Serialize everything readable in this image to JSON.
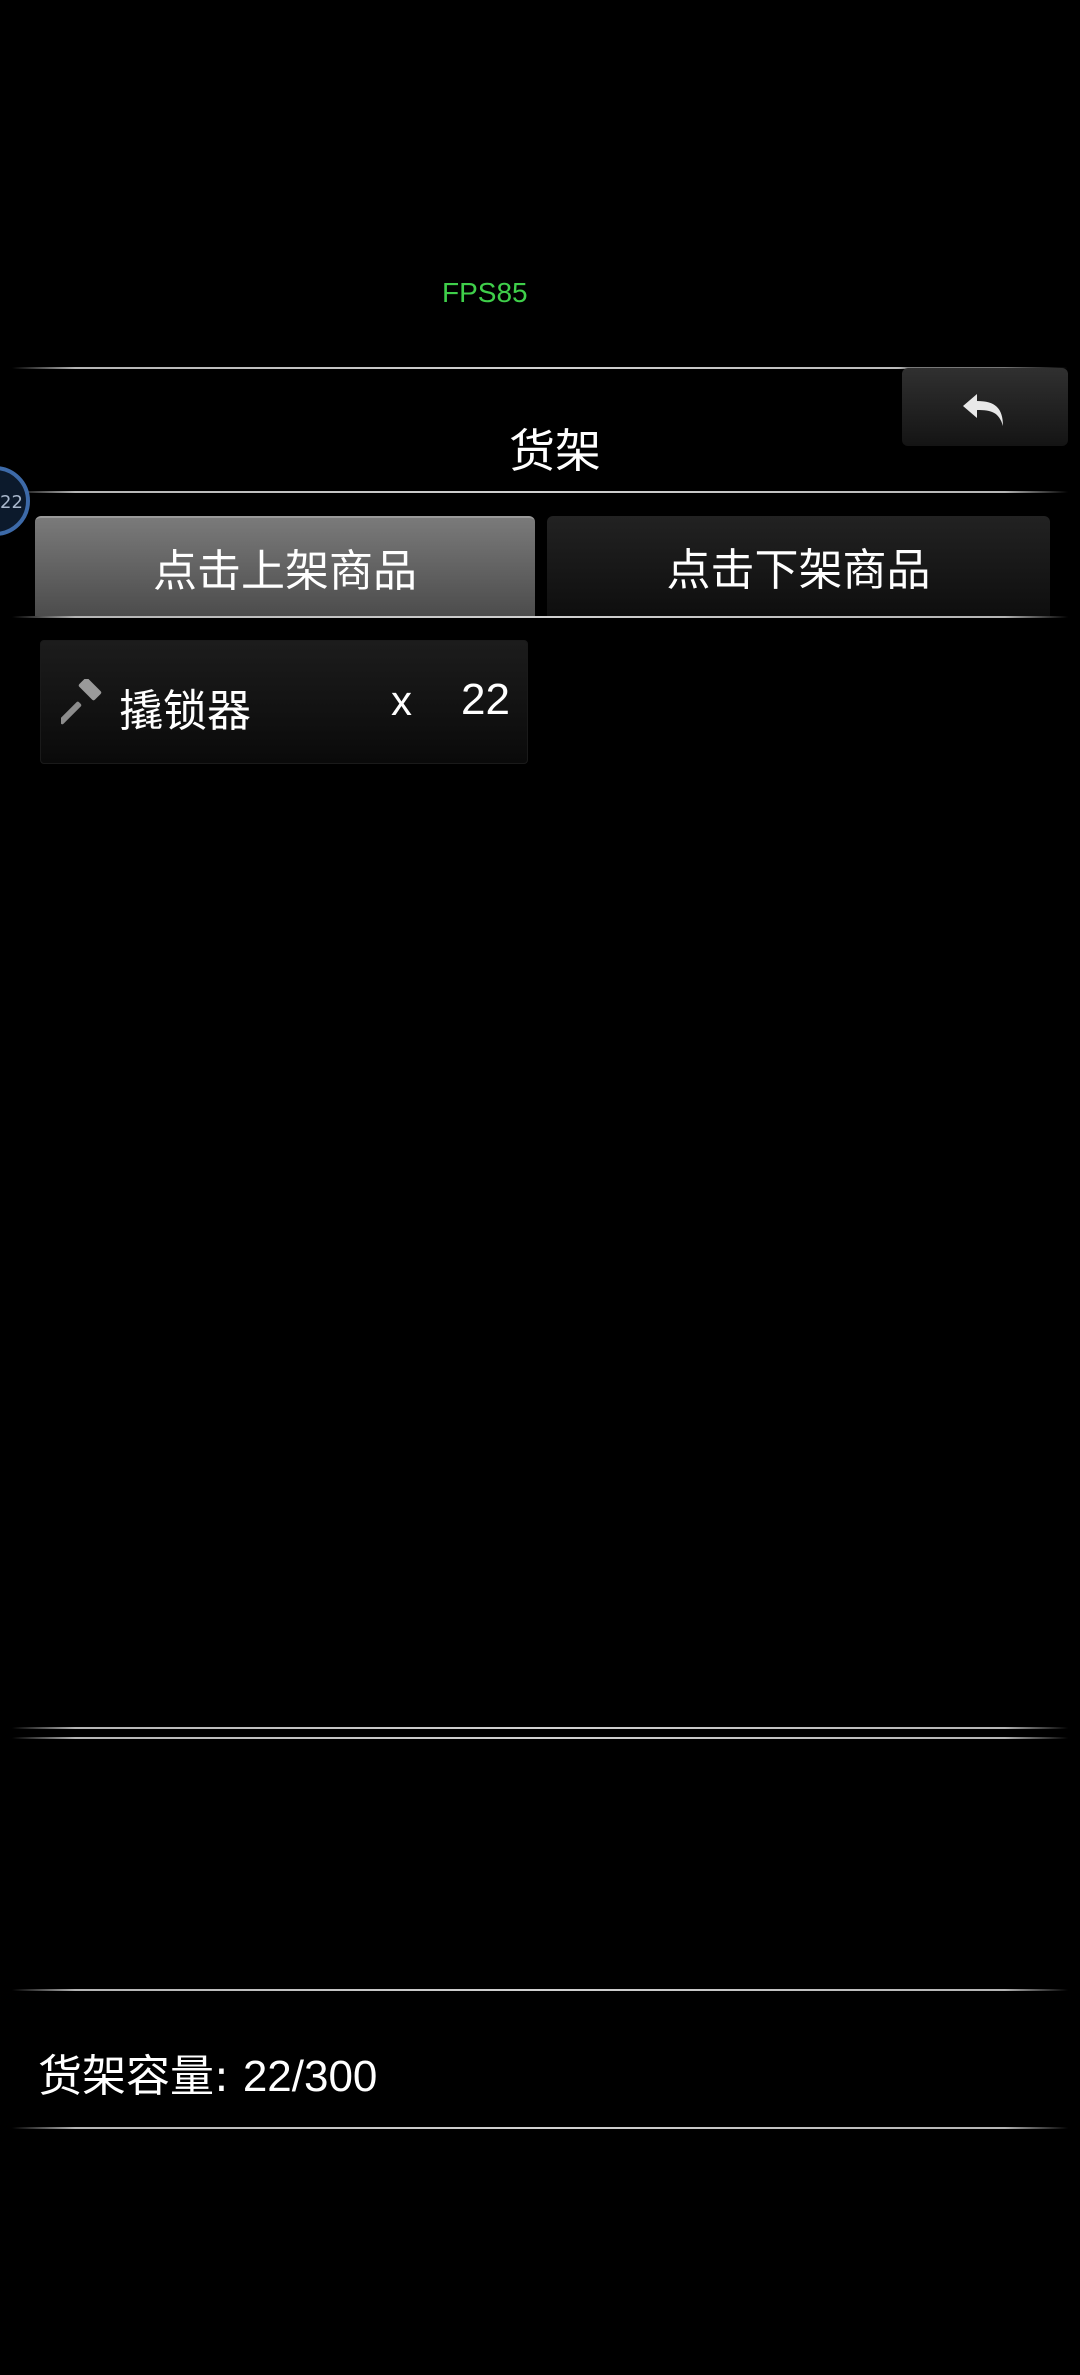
{
  "hud": {
    "fps_label": "FPS85"
  },
  "header": {
    "title": "货架",
    "back_icon": "back-arrow-icon"
  },
  "avatar": {
    "partial_text": "22"
  },
  "tabs": [
    {
      "label": "点击上架商品",
      "active": true
    },
    {
      "label": "点击下架商品",
      "active": false
    }
  ],
  "items": [
    {
      "icon": "hammer-icon",
      "name": "撬锁器",
      "x_label": "x",
      "quantity": "22"
    }
  ],
  "footer": {
    "capacity_label": "货架容量: ",
    "capacity_value": "22/300"
  },
  "colors": {
    "background": "#000000",
    "fps_green": "#3fcf4a",
    "tab_active": "#6a6a6a",
    "tab_inactive": "#151515"
  }
}
